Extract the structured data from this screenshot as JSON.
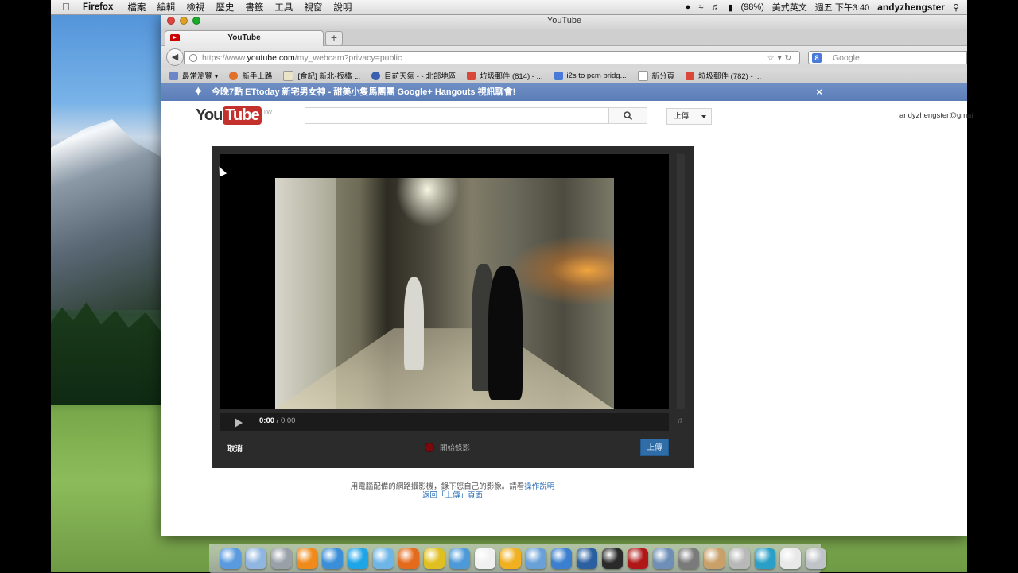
{
  "menubar": {
    "app": "Firefox",
    "menus": [
      "檔案",
      "編輯",
      "檢視",
      "歷史",
      "書籤",
      "工具",
      "視窗",
      "說明"
    ],
    "battery": "(98%)",
    "input_method": "美式英文",
    "clock": "週五 下午3:40",
    "user": "andyzhengster"
  },
  "window": {
    "title": "YouTube",
    "tab_label": "YouTube",
    "new_tab": "+",
    "url_prefix": "https://www.",
    "url_host": "youtube.com",
    "url_path": "/my_webcam?privacy=public",
    "search_placeholder": "Google",
    "search_engine": "8"
  },
  "bookmarks": [
    {
      "label": "最常瀏覽 ▾",
      "icon": "most-visited-icon",
      "color": "#6d86c8"
    },
    {
      "label": "新手上路",
      "icon": "firefox-icon",
      "color": "#e0702a"
    },
    {
      "label": "[食記] 新北-板橋 ...",
      "icon": "page-icon",
      "color": "#e9e4c8"
    },
    {
      "label": "目前天氣 - - 北部地區",
      "icon": "weather-icon",
      "color": "#3a5fae"
    },
    {
      "label": "垃圾郵件 (814) - ...",
      "icon": "gmail-icon",
      "color": "#d8473a"
    },
    {
      "label": "i2s to pcm bridg...",
      "icon": "google-icon",
      "color": "#4a7ad8"
    },
    {
      "label": "新分頁",
      "icon": "blank-page-icon",
      "color": "#ffffff"
    },
    {
      "label": "垃圾郵件 (782) - ...",
      "icon": "gmail-icon",
      "color": "#d8473a"
    }
  ],
  "banner": {
    "text": "今晚7點 ETtoday 新宅男女神 - 甜美小隻馬團團 Google+ Hangouts 視訊聊會!",
    "close": "×"
  },
  "youtube": {
    "logo_you": "You",
    "logo_tube": "Tube",
    "logo_region": "TW",
    "upload_label": "上傳",
    "account": "andyzhengster@gmai"
  },
  "recorder": {
    "time_current": "0:00",
    "time_sep": " / ",
    "time_total": "0:00",
    "cancel_label": "取消",
    "record_label": "開始錄影",
    "upload_label": "上傳"
  },
  "caption": {
    "line1_text": "用電腦配備的網路攝影機，錄下您自己的影像。請看",
    "line1_link": "操作說明",
    "line2_link": "返回「上傳」頁面"
  },
  "dock_icons": [
    {
      "name": "finder-icon",
      "color": "#5a9be0"
    },
    {
      "name": "folder-icon",
      "color": "#8fb6e0"
    },
    {
      "name": "launchpad-icon",
      "color": "#9aa0a8"
    },
    {
      "name": "vlc-icon",
      "color": "#f08a1a"
    },
    {
      "name": "hand-tool-icon",
      "color": "#3b8fd8"
    },
    {
      "name": "skype-icon",
      "color": "#1ea5e8"
    },
    {
      "name": "cloud-icon",
      "color": "#6fb6e8"
    },
    {
      "name": "firefox-icon",
      "color": "#e46a1c"
    },
    {
      "name": "chrome-icon",
      "color": "#e0c020"
    },
    {
      "name": "safari-icon",
      "color": "#4e9ad8"
    },
    {
      "name": "textedit-icon",
      "color": "#f0f0f0"
    },
    {
      "name": "media-player-icon",
      "color": "#f0b020"
    },
    {
      "name": "network-icon",
      "color": "#6aa0d8"
    },
    {
      "name": "itunes-icon",
      "color": "#3a7fd0"
    },
    {
      "name": "quicktime-icon",
      "color": "#2a5fa0"
    },
    {
      "name": "monitor-icon",
      "color": "#2a2a2a"
    },
    {
      "name": "photo-booth-icon",
      "color": "#b01818"
    },
    {
      "name": "xcode-icon",
      "color": "#6f8fb8"
    },
    {
      "name": "webcam-icon",
      "color": "#7a7a7a"
    },
    {
      "name": "coffee-icon",
      "color": "#c9a06a"
    },
    {
      "name": "printer-icon",
      "color": "#b8b8b8"
    },
    {
      "name": "time-machine-icon",
      "color": "#2aa0c8"
    },
    {
      "name": "document-icon",
      "color": "#e8e8e8"
    },
    {
      "name": "trash-icon",
      "color": "#c0c4c8"
    }
  ]
}
